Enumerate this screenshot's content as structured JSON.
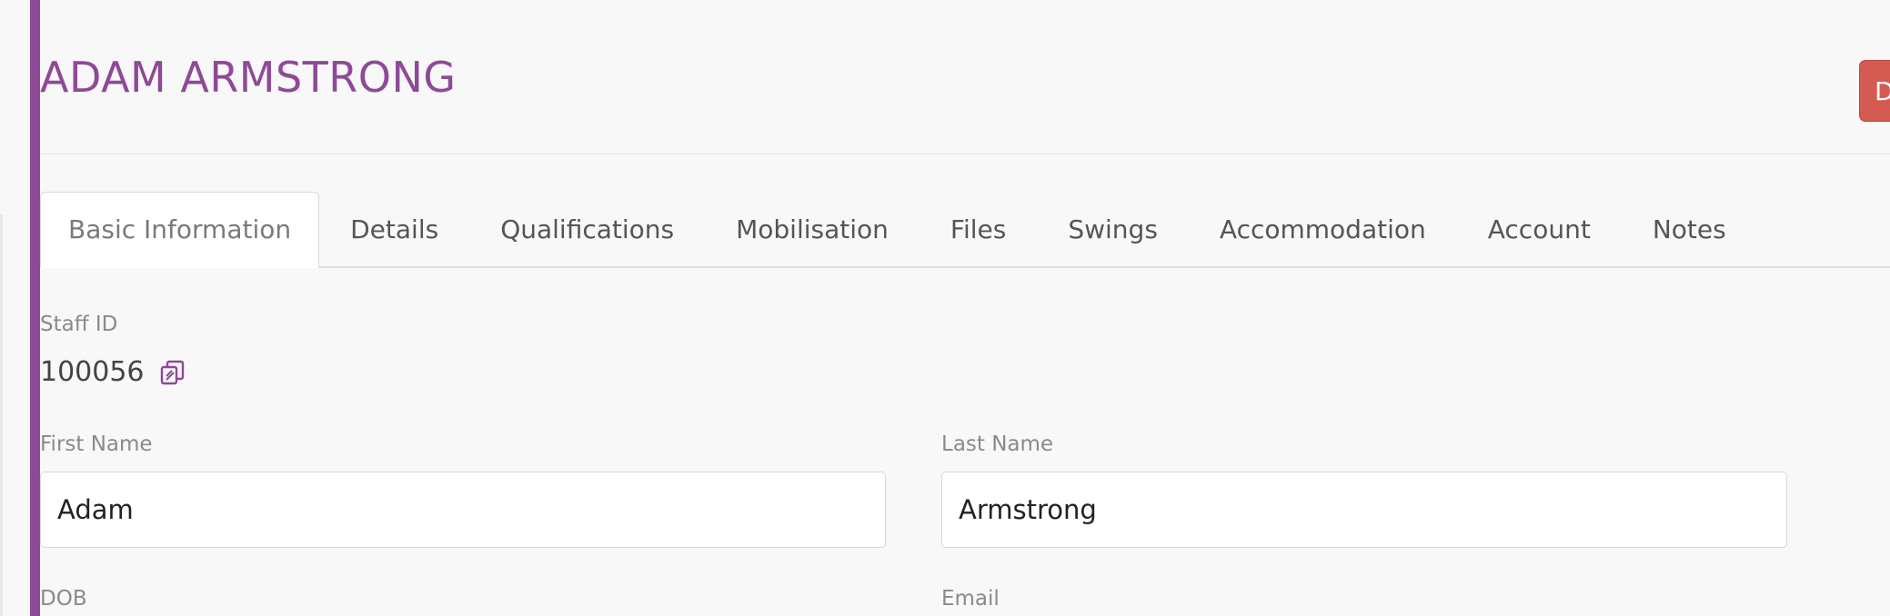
{
  "header": {
    "title": "ADAM ARMSTRONG",
    "danger_button_label": "D"
  },
  "tabs": [
    {
      "label": "Basic Information",
      "active": true
    },
    {
      "label": "Details"
    },
    {
      "label": "Qualifications"
    },
    {
      "label": "Mobilisation"
    },
    {
      "label": "Files"
    },
    {
      "label": "Swings"
    },
    {
      "label": "Accommodation"
    },
    {
      "label": "Account"
    },
    {
      "label": "Notes"
    }
  ],
  "form": {
    "staff_id_label": "Staff ID",
    "staff_id_value": "100056",
    "first_name_label": "First Name",
    "first_name_value": "Adam",
    "last_name_label": "Last Name",
    "last_name_value": "Armstrong",
    "dob_label": "DOB",
    "email_label": "Email"
  },
  "icons": {
    "copy": "copy-icon"
  },
  "colors": {
    "accent": "#8e4a96",
    "danger": "#d45a52",
    "background": "#f8f8f9"
  }
}
